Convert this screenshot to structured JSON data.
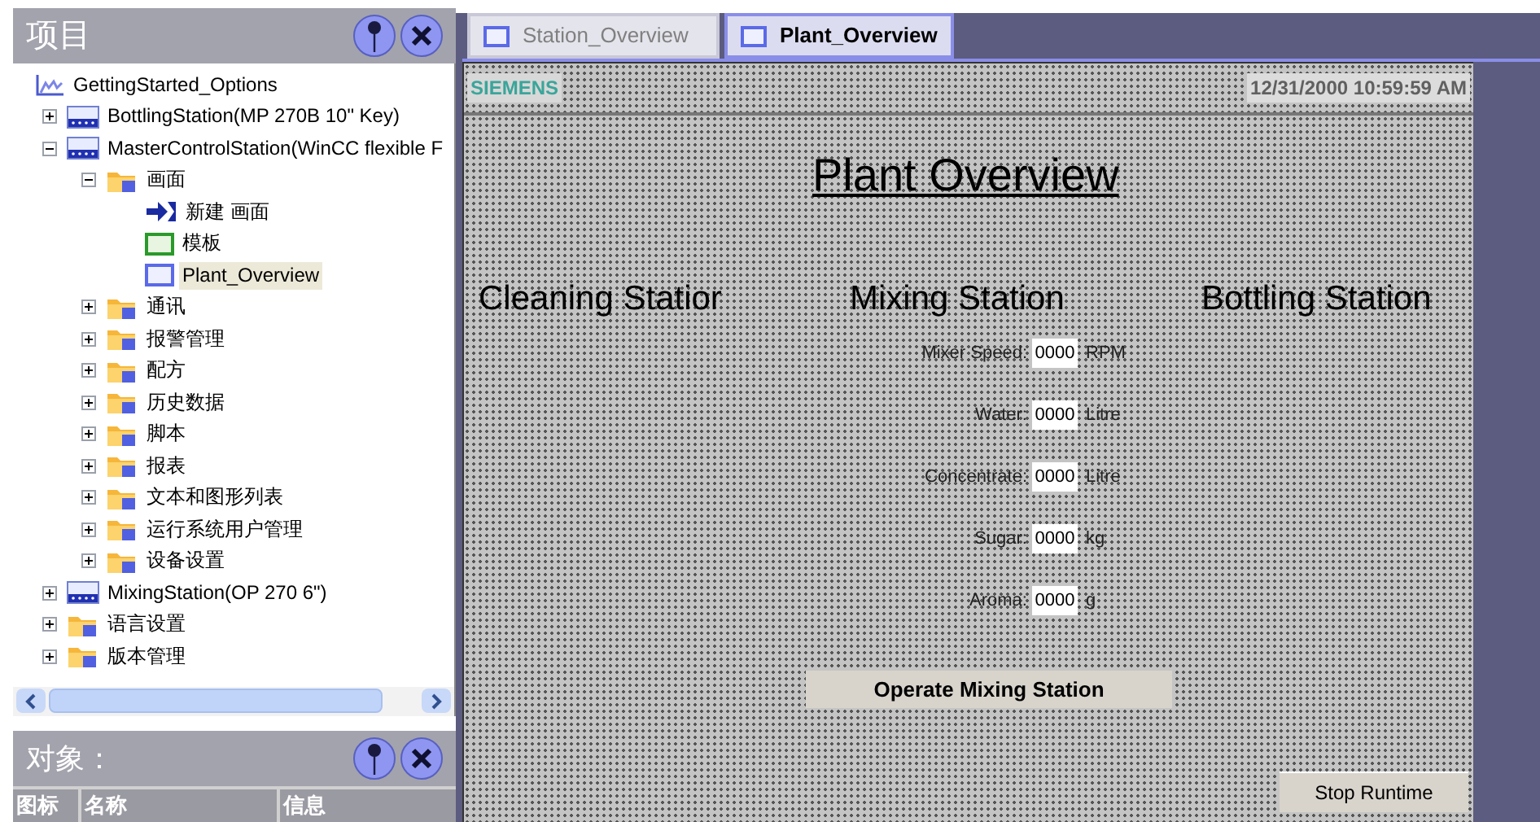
{
  "project_panel": {
    "title": "项目",
    "tree": [
      {
        "label": "GettingStarted_Options",
        "kind": "project",
        "selected": false,
        "children": [
          {
            "label": "BottlingStation(MP 270B 10\" Key)",
            "kind": "device",
            "expanded": false,
            "selected": false
          },
          {
            "label": "MasterControlStation(WinCC flexible F",
            "kind": "device",
            "expanded": true,
            "selected": false,
            "children": [
              {
                "label": "画面",
                "kind": "folder",
                "expanded": true,
                "selected": false,
                "children": [
                  {
                    "label": "新建 画面",
                    "kind": "new",
                    "selected": false
                  },
                  {
                    "label": "模板",
                    "kind": "template",
                    "selected": false
                  },
                  {
                    "label": "Plant_Overview",
                    "kind": "screen",
                    "selected": true
                  }
                ]
              },
              {
                "label": "通讯",
                "kind": "folder",
                "expanded": false,
                "selected": false
              },
              {
                "label": "报警管理",
                "kind": "folder",
                "expanded": false,
                "selected": false
              },
              {
                "label": "配方",
                "kind": "folder",
                "expanded": false,
                "selected": false
              },
              {
                "label": "历史数据",
                "kind": "folder",
                "expanded": false,
                "selected": false
              },
              {
                "label": "脚本",
                "kind": "folder",
                "expanded": false,
                "selected": false
              },
              {
                "label": "报表",
                "kind": "folder",
                "expanded": false,
                "selected": false
              },
              {
                "label": "文本和图形列表",
                "kind": "folder",
                "expanded": false,
                "selected": false
              },
              {
                "label": "运行系统用户管理",
                "kind": "folder",
                "expanded": false,
                "selected": false
              },
              {
                "label": "设备设置",
                "kind": "folder",
                "expanded": false,
                "selected": false
              }
            ]
          },
          {
            "label": "MixingStation(OP 270 6\")",
            "kind": "device",
            "expanded": false,
            "selected": false
          },
          {
            "label": "语言设置",
            "kind": "folder",
            "expanded": false,
            "selected": false
          },
          {
            "label": "版本管理",
            "kind": "folder",
            "expanded": false,
            "selected": false
          }
        ]
      }
    ]
  },
  "objects_panel": {
    "title": "对象：",
    "columns": [
      "图标",
      "名称",
      "信息"
    ]
  },
  "tabs": [
    {
      "label": "Station_Overview",
      "selected": false
    },
    {
      "label": "Plant_Overview",
      "selected": true
    }
  ],
  "screen": {
    "brand": "SIEMENS",
    "datetime": "12/31/2000 10:59:59 AM",
    "title": "Plant Overview",
    "stations": [
      "Cleaning Statior",
      "Mixing Station",
      "Bottling Station"
    ],
    "fields": [
      {
        "label": "Mixer Speed:",
        "value": "0000",
        "unit": "RPM"
      },
      {
        "label": "Water:",
        "value": "0000",
        "unit": "Litre"
      },
      {
        "label": "Concentrate:",
        "value": "0000",
        "unit": "Litre"
      },
      {
        "label": "Sugar:",
        "value": "0000",
        "unit": "kg"
      },
      {
        "label": "Aroma:",
        "value": "0000",
        "unit": "g"
      }
    ],
    "operate_button": "Operate Mixing Station",
    "stop_button": "Stop Runtime"
  }
}
